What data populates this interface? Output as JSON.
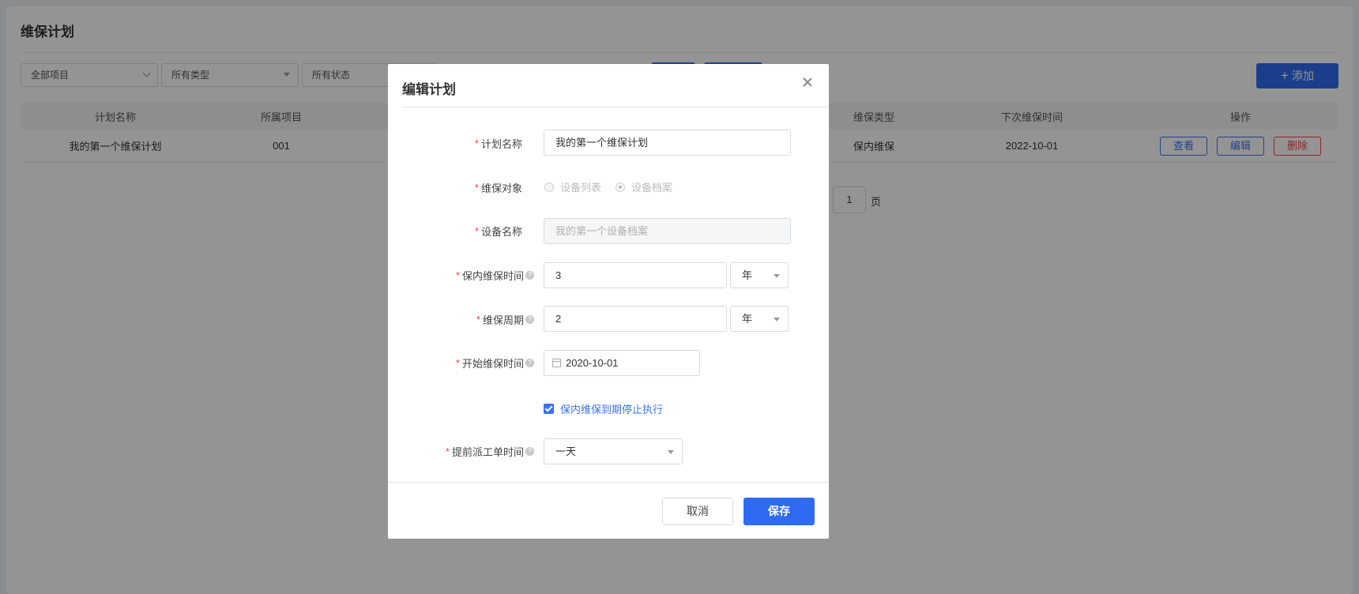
{
  "page": {
    "title": "维保计划",
    "filters": {
      "project": "全部项目",
      "type": "所有类型",
      "status": "所有状态"
    },
    "add_label": "添加",
    "table": {
      "headers": [
        "计划名称",
        "所属项目",
        "维保类型",
        "下次维保时间",
        "操作"
      ],
      "row": {
        "name": "我的第一个维保计划",
        "project": "001",
        "type": "保内维保",
        "next_time": "2022-10-01"
      },
      "actions": {
        "view": "查看",
        "edit": "编辑",
        "delete": "删除"
      }
    },
    "pager": {
      "page": "1",
      "unit": "页"
    }
  },
  "dialog": {
    "title": "编辑计划",
    "fields": {
      "plan_name": {
        "label": "计划名称",
        "value": "我的第一个维保计划"
      },
      "target": {
        "label": "维保对象",
        "options": [
          "设备列表",
          "设备档案"
        ],
        "selected": "设备档案"
      },
      "device_name": {
        "label": "设备名称",
        "value": "我的第一个设备档案"
      },
      "warranty_time": {
        "label": "保内维保时间",
        "value": "3",
        "unit": "年"
      },
      "cycle": {
        "label": "维保周期",
        "value": "2",
        "unit": "年"
      },
      "start_time": {
        "label": "开始维保时间",
        "value": "2020-10-01"
      },
      "stop_checkbox": {
        "label": "保内维保到期停止执行",
        "checked": true
      },
      "advance": {
        "label": "提前派工单时间",
        "value": "一天"
      }
    },
    "cancel_label": "取消",
    "save_label": "保存"
  },
  "colors": {
    "primary": "#2f6bf0",
    "danger": "#ee4444",
    "required": "#f04444"
  },
  "icons": {
    "close": "close-icon",
    "calendar": "calendar-icon",
    "help": "question-icon",
    "caret": "caret-down-icon"
  }
}
